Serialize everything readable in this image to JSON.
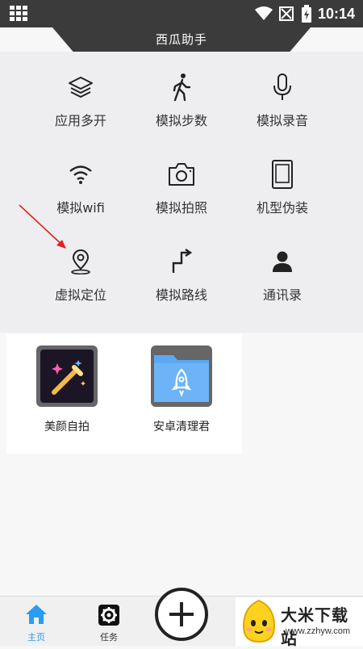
{
  "status_bar": {
    "time": "10:14",
    "icons": [
      "apps-grid-icon",
      "wifi-icon",
      "no-signal-icon",
      "battery-charging-icon"
    ]
  },
  "app": {
    "title": "西瓜助手"
  },
  "tools": [
    {
      "label": "应用多开",
      "icon": "layers-icon"
    },
    {
      "label": "模拟步数",
      "icon": "walking-icon"
    },
    {
      "label": "模拟录音",
      "icon": "microphone-icon"
    },
    {
      "label": "模拟wifi",
      "icon": "wifi-icon"
    },
    {
      "label": "模拟拍照",
      "icon": "camera-icon"
    },
    {
      "label": "机型伪装",
      "icon": "phone-device-icon"
    },
    {
      "label": "虚拟定位",
      "icon": "location-pin-icon"
    },
    {
      "label": "模拟路线",
      "icon": "route-icon"
    },
    {
      "label": "通讯录",
      "icon": "contacts-icon"
    }
  ],
  "apps": [
    {
      "label": "美颜自拍",
      "icon": "magic-wand-icon"
    },
    {
      "label": "安卓清理君",
      "icon": "rocket-folder-icon"
    }
  ],
  "bottom_nav": {
    "home_label": "主页",
    "tasks_label": "任务"
  },
  "watermark": {
    "title": "大米下载站",
    "url": "www.zzhyw.com"
  },
  "colors": {
    "dark": "#3b3b3b",
    "panel_bg": "#eeeef0",
    "active_tab": "#2b9cf0",
    "annotation_arrow": "#e02020",
    "folder_blue": "#5aa9f5"
  }
}
